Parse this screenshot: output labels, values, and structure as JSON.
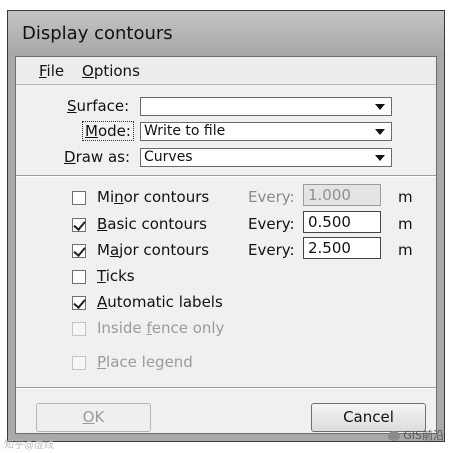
{
  "window": {
    "title": "Display contours"
  },
  "menu": [
    {
      "first": "F",
      "rest": "ile"
    },
    {
      "first": "O",
      "rest": "ptions"
    }
  ],
  "surface": {
    "label_u": "S",
    "label_rest": "urface:",
    "value": ""
  },
  "mode": {
    "label_u": "M",
    "label_rest": "ode:",
    "value": "Write to file"
  },
  "draw_as": {
    "label_u": "D",
    "label_rest": "raw as:",
    "value": "Curves"
  },
  "options": {
    "minor": {
      "pre": "Mi",
      "u": "n",
      "post": "or contours",
      "checked": false,
      "enabled": true,
      "every_label": "Every:",
      "value": "1.000",
      "field_enabled": false,
      "unit": "m"
    },
    "basic": {
      "pre": "",
      "u": "B",
      "post": "asic contours",
      "checked": true,
      "enabled": true,
      "every_label": "Every:",
      "value": "0.500",
      "field_enabled": true,
      "unit": "m"
    },
    "major": {
      "pre": "M",
      "u": "a",
      "post": "jor contours",
      "checked": true,
      "enabled": true,
      "every_label": "Every:",
      "value": "2.500",
      "field_enabled": true,
      "unit": "m"
    },
    "ticks": {
      "pre": "",
      "u": "T",
      "post": "icks",
      "checked": false,
      "enabled": true
    },
    "auto_labels": {
      "pre": "",
      "u": "A",
      "post": "utomatic labels",
      "checked": true,
      "enabled": true
    },
    "inside_fence": {
      "pre": "Inside ",
      "u": "f",
      "post": "ence only",
      "checked": false,
      "enabled": false
    },
    "place_legend": {
      "pre": "",
      "u": "P",
      "post": "lace legend",
      "checked": false,
      "enabled": false
    }
  },
  "buttons": {
    "ok": {
      "u": "O",
      "rest": "K",
      "enabled": false
    },
    "cancel": {
      "label": "Cancel",
      "enabled": true
    }
  },
  "watermark": {
    "left": "知乎@虚线",
    "right": "GIS前沿"
  }
}
